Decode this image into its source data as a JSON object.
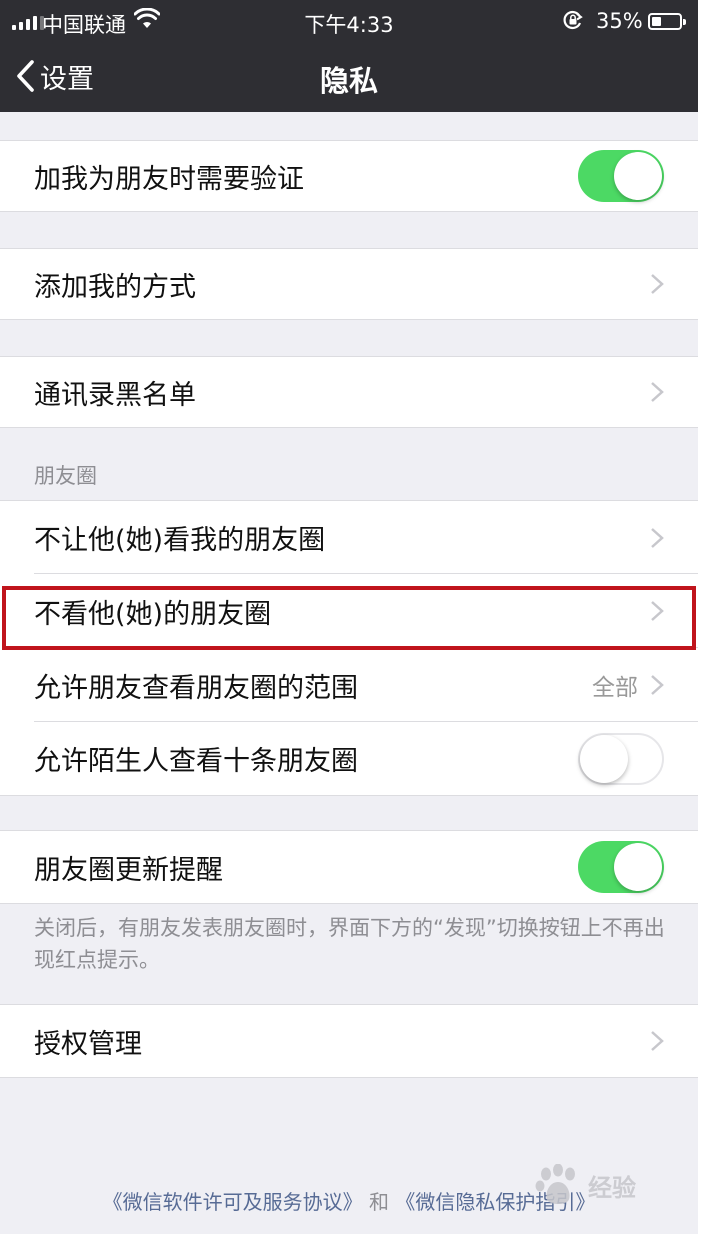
{
  "status_bar": {
    "carrier": "中国联通",
    "time": "下午4:33",
    "battery_percent": "35%",
    "battery_level": 0.35,
    "icons": [
      "signal-icon",
      "wifi-icon",
      "orientation-lock-icon",
      "battery-icon"
    ]
  },
  "nav": {
    "back_label": "设置",
    "title": "隐私"
  },
  "settings": {
    "verify_friend": {
      "label": "加我为朋友时需要验证",
      "toggle": true
    },
    "add_me_methods": {
      "label": "添加我的方式"
    },
    "blacklist": {
      "label": "通讯录黑名单"
    },
    "moments_section_header": "朋友圈",
    "hide_my_moments": {
      "label": "不让他(她)看我的朋友圈"
    },
    "dont_see_their_moments": {
      "label": "不看他(她)的朋友圈",
      "highlighted": true
    },
    "moments_visible_range": {
      "label": "允许朋友查看朋友圈的范围",
      "value": "全部"
    },
    "strangers_view_ten": {
      "label": "允许陌生人查看十条朋友圈",
      "toggle": false
    },
    "moments_update_reminder": {
      "label": "朋友圈更新提醒",
      "toggle": true
    },
    "reminder_footnote": "关闭后，有朋友发表朋友圈时，界面下方的“发现”切换按钮上不再出现红点提示。",
    "authorization_management": {
      "label": "授权管理"
    }
  },
  "footer": {
    "license_link": "《微信软件许可及服务协议》",
    "and_text": "和",
    "privacy_link": "《微信隐私保护指引》"
  },
  "watermark": {
    "logo_text": "经验"
  },
  "colors": {
    "nav_background": "#2e2e33",
    "page_background": "#efeff4",
    "toggle_on": "#4cd964",
    "highlight_border": "#c0141c",
    "link": "#576b95"
  }
}
